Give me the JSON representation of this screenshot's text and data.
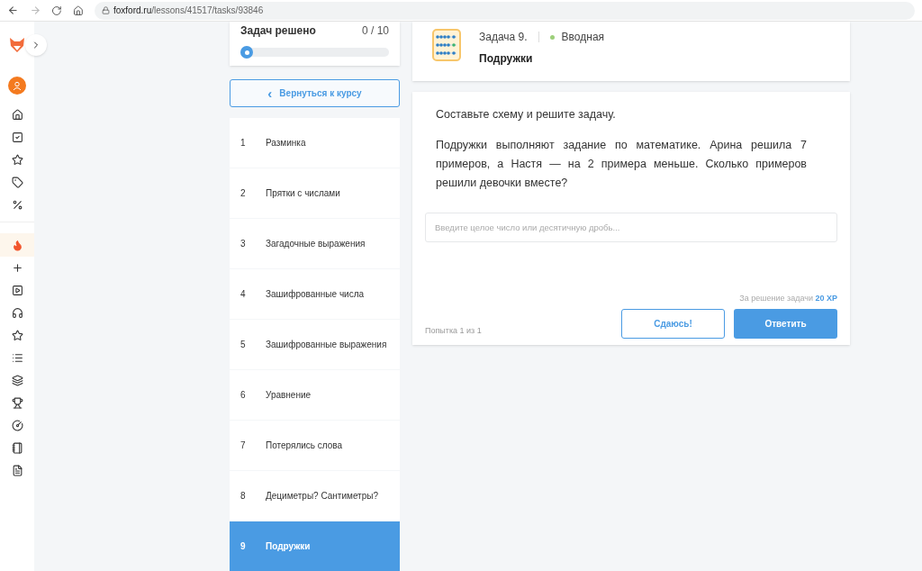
{
  "browser": {
    "url_host": "foxford.ru",
    "url_path": "/lessons/41517/tasks/93846"
  },
  "progress": {
    "label": "Задач решено",
    "count": "0 / 10",
    "level": 0
  },
  "back_button": {
    "arrow": "‹",
    "label": "Вернуться к курсу"
  },
  "lessons": [
    {
      "number": "1",
      "title": "Разминка",
      "selected": false
    },
    {
      "number": "2",
      "title": "Прятки с числами",
      "selected": false
    },
    {
      "number": "3",
      "title": "Загадочные выражения",
      "selected": false
    },
    {
      "number": "4",
      "title": "Зашифрованные числа",
      "selected": false
    },
    {
      "number": "5",
      "title": "Зашифрованные выражения",
      "selected": false
    },
    {
      "number": "6",
      "title": "Уравнение",
      "selected": false
    },
    {
      "number": "7",
      "title": "Потерялись слова",
      "selected": false
    },
    {
      "number": "8",
      "title": "Дециметры? Сантиметры?",
      "selected": false
    },
    {
      "number": "9",
      "title": "Подружки",
      "selected": true
    }
  ],
  "task_header": {
    "number": "Задача 9.",
    "level": {
      "label": "Вводная",
      "color": "#9ccf7a"
    },
    "title": "Подружки"
  },
  "task": {
    "instruction": "Составьте схему и решите задачу.",
    "text": "Подружки выполняют задание по математике. Арина решила 7 примеров, а Настя — на 2 примера меньше. Сколько примеров решили девочки вместе?",
    "answer_placeholder": "Введите целое число или десятичную дробь...",
    "reward_label": "За решение задачи",
    "reward_value": "20 XP",
    "attempts": "Попытка 1 из 1",
    "give_up_button": "Сдаюсь!",
    "submit_button": "Ответить"
  }
}
